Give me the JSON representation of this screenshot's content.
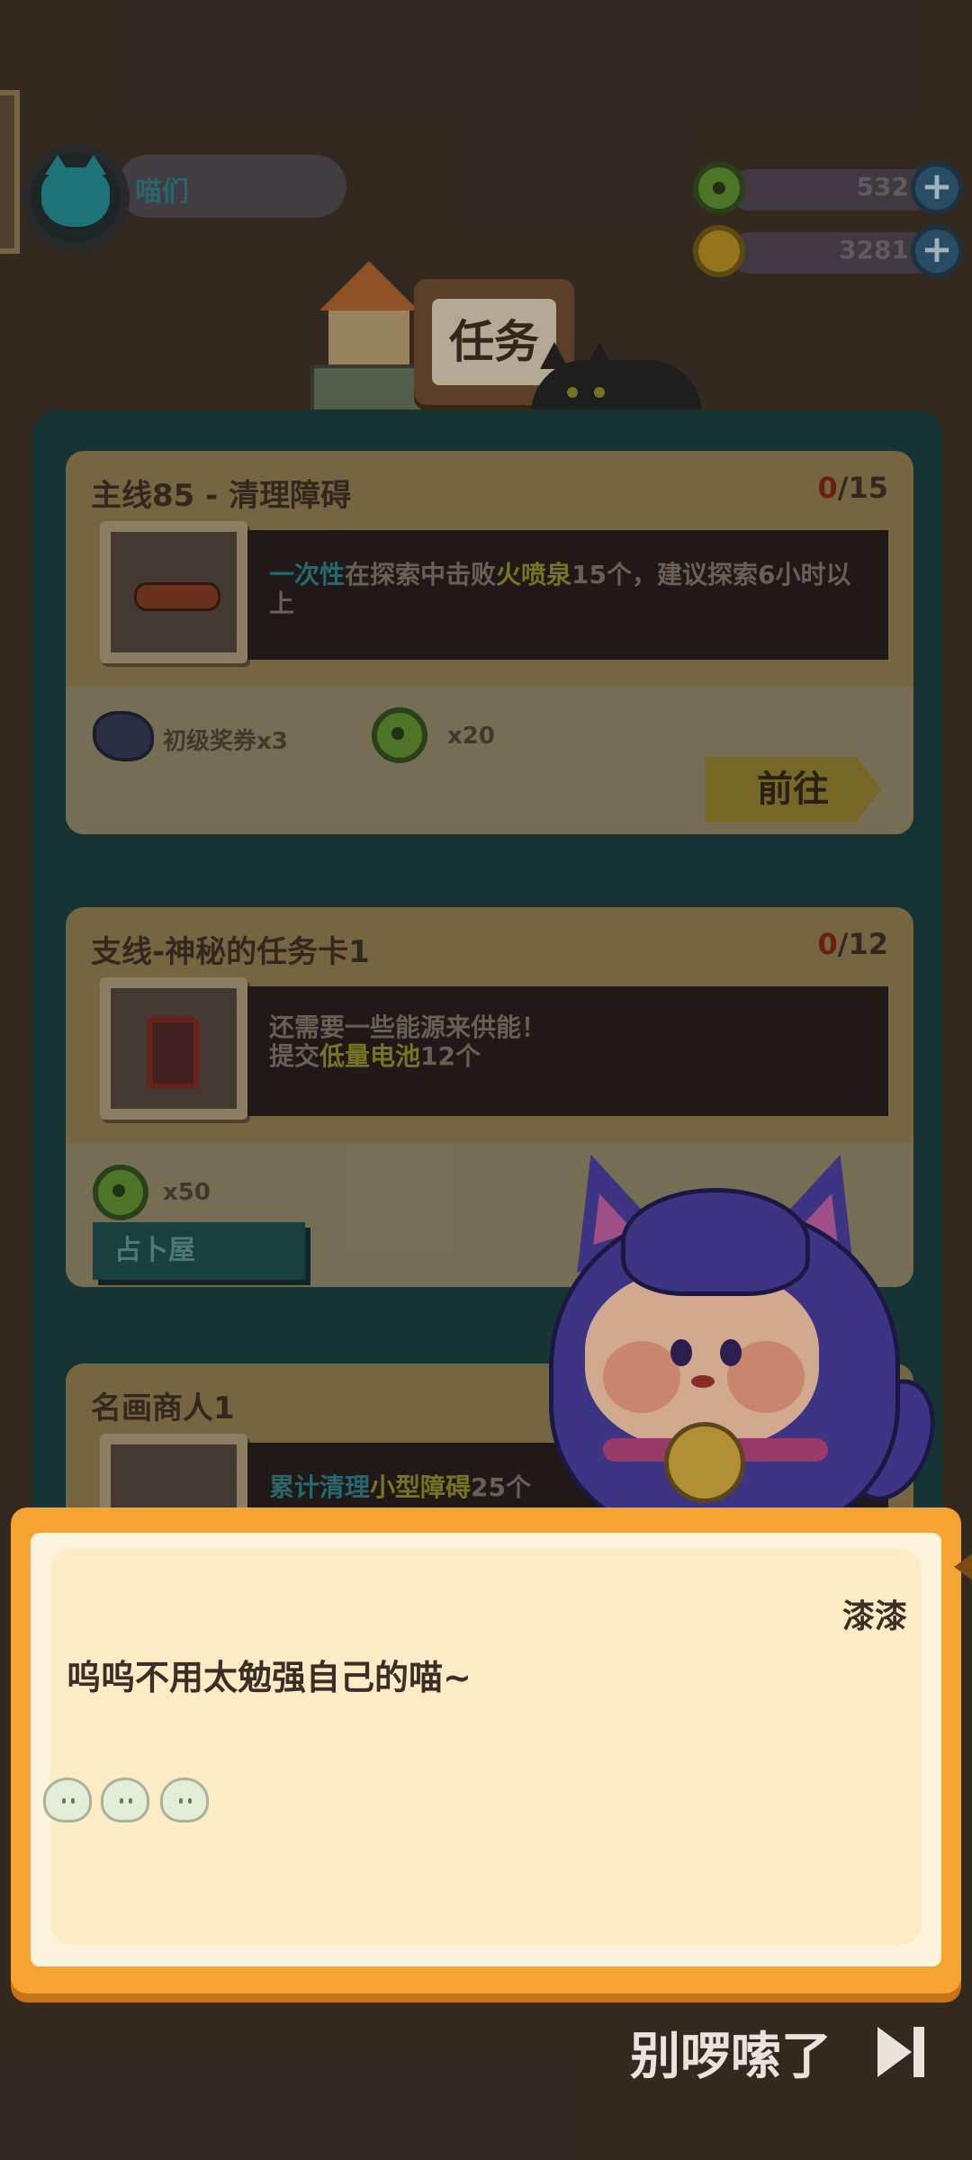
{
  "player": {
    "name": "喵们"
  },
  "resources": [
    {
      "icon": "green-coin-icon",
      "value": "532"
    },
    {
      "icon": "gold-coin-icon",
      "value": "3281"
    }
  ],
  "header": {
    "title": "任务"
  },
  "quests": [
    {
      "title": "主线85 - 清理障碍",
      "progress_done": "0",
      "progress_total": "/15",
      "desc_parts": [
        "一次性",
        "在探索中击败",
        "火喷泉",
        "15个，建议探索6小时以上"
      ],
      "rewards": [
        {
          "icon": "ticket-icon",
          "label": "初级奖券x3"
        },
        {
          "icon": "green-coin-icon",
          "label": "x20"
        }
      ],
      "action": "前往"
    },
    {
      "title": "支线-神秘的任务卡1",
      "progress_done": "0",
      "progress_total": "/12",
      "desc_line1": "还需要一些能源来供能！",
      "desc_parts": [
        "提交",
        "低量电池",
        "12个"
      ],
      "rewards": [
        {
          "icon": "green-coin-icon",
          "label": "x50"
        }
      ],
      "location_tag": "占卜屋"
    },
    {
      "title": "名画商人1",
      "desc_parts": [
        "累计清理",
        "小型障碍",
        "25个"
      ]
    }
  ],
  "dialog": {
    "speaker": "漆漆",
    "text": "呜呜不用太勉强自己的喵~"
  },
  "skip": {
    "label": "别啰嗦了"
  }
}
